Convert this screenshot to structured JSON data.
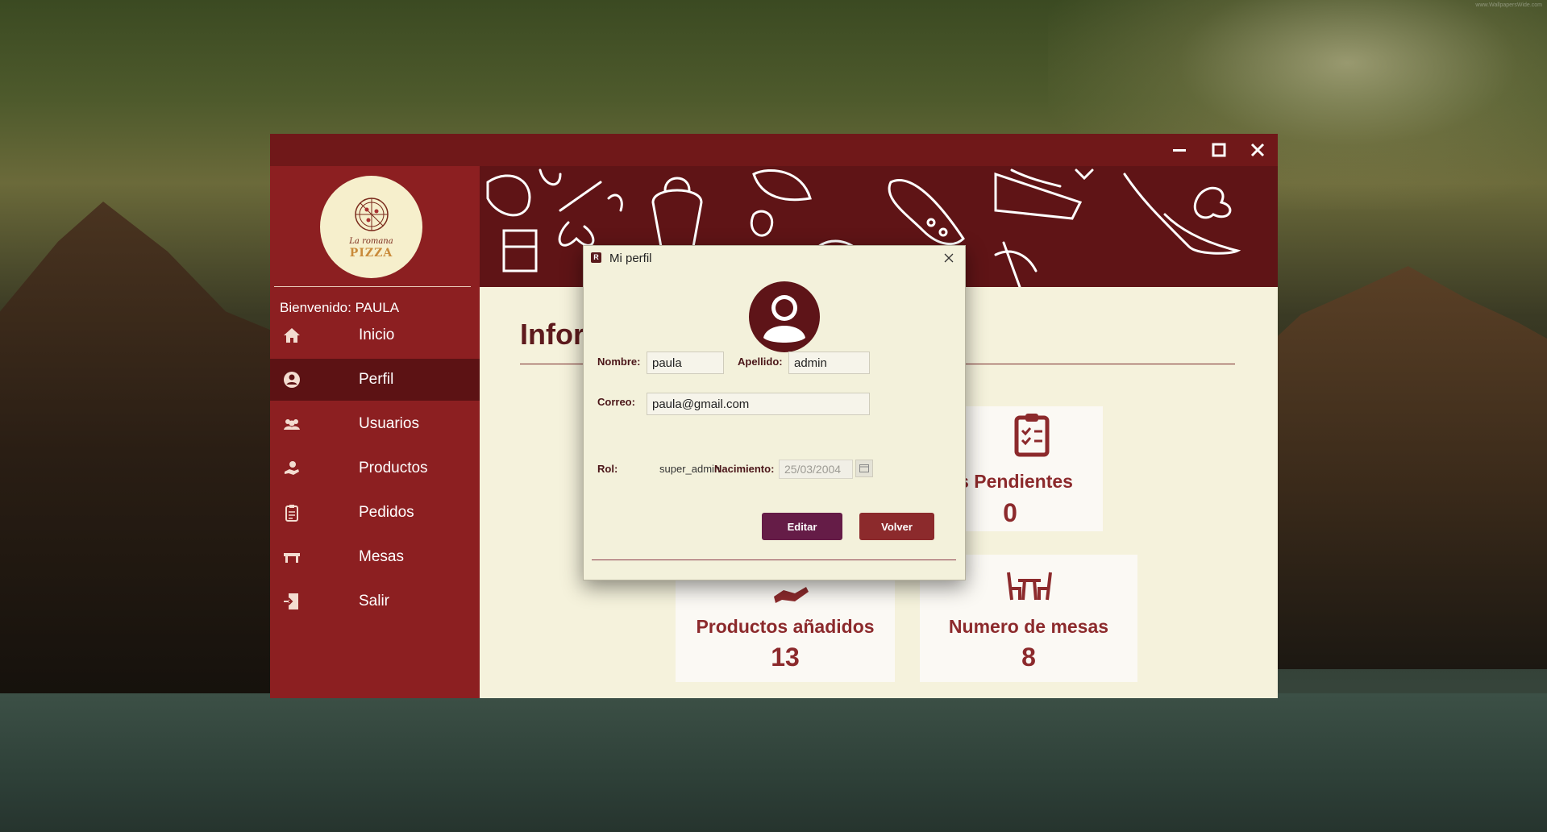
{
  "desktop": {
    "watermark": "www.WallpapersWide.com"
  },
  "window": {
    "title": ""
  },
  "sidebar": {
    "logo": {
      "line1": "La romana",
      "line2": "PIZZA"
    },
    "welcome": "Bienvenido: PAULA",
    "items": [
      {
        "label": "Inicio",
        "icon": "home-icon"
      },
      {
        "label": "Perfil",
        "icon": "user-icon",
        "active": true
      },
      {
        "label": "Usuarios",
        "icon": "users-icon"
      },
      {
        "label": "Productos",
        "icon": "product-icon"
      },
      {
        "label": "Pedidos",
        "icon": "clipboard-icon"
      },
      {
        "label": "Mesas",
        "icon": "table-icon"
      },
      {
        "label": "Salir",
        "icon": "exit-icon"
      }
    ]
  },
  "main": {
    "title": "Infor",
    "cards": [
      {
        "label": "os Pendientes",
        "value": "0",
        "icon": "clipboard-list-icon"
      },
      {
        "label": "Productos añadidos",
        "value": "13",
        "icon": "hand-product-icon"
      },
      {
        "label": "Numero de mesas",
        "value": "8",
        "icon": "table-chairs-icon"
      }
    ]
  },
  "dialog": {
    "title": "Mi perfil",
    "labels": {
      "nombre": "Nombre:",
      "apellido": "Apellido:",
      "correo": "Correo:",
      "rol": "Rol:",
      "nacimiento": "Nacimiento:"
    },
    "values": {
      "nombre": "paula",
      "apellido": "admin",
      "correo": "paula@gmail.com",
      "rol": "super_admin",
      "nacimiento": "25/03/2004"
    },
    "buttons": {
      "edit": "Editar",
      "back": "Volver"
    }
  },
  "colors": {
    "titlebar": "#701819",
    "sidebar": "#8c1f21",
    "sidebar_active": "#5c1214",
    "accent": "#8c2a2c",
    "edit_button": "#651c47",
    "background": "#f5f2dc"
  }
}
